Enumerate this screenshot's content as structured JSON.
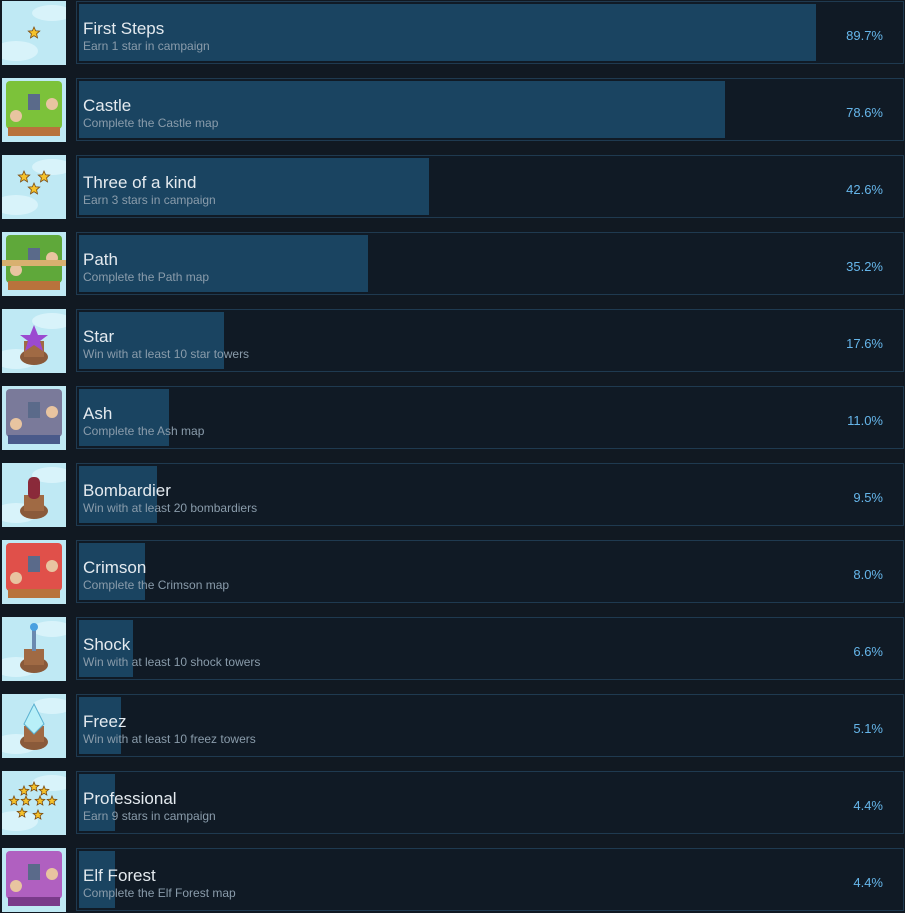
{
  "colors": {
    "bar": "#1a4461",
    "percent": "#66b6ea",
    "background": "#111922"
  },
  "achievements": [
    {
      "title": "First Steps",
      "description": "Earn 1 star in campaign",
      "percent": "89.7%",
      "value": 89.7,
      "icon": "one-star-icon",
      "theme": "sky"
    },
    {
      "title": "Castle",
      "description": "Complete the Castle map",
      "percent": "78.6%",
      "value": 78.6,
      "icon": "castle-map-icon",
      "theme": "green"
    },
    {
      "title": "Three of a kind",
      "description": "Earn 3 stars in campaign",
      "percent": "42.6%",
      "value": 42.6,
      "icon": "three-stars-icon",
      "theme": "sky"
    },
    {
      "title": "Path",
      "description": "Complete the Path map",
      "percent": "35.2%",
      "value": 35.2,
      "icon": "path-map-icon",
      "theme": "green"
    },
    {
      "title": "Star",
      "description": "Win with at least 10 star towers",
      "percent": "17.6%",
      "value": 17.6,
      "icon": "star-tower-icon",
      "theme": "tower-purple"
    },
    {
      "title": "Ash",
      "description": "Complete the Ash map",
      "percent": "11.0%",
      "value": 11.0,
      "icon": "ash-map-icon",
      "theme": "ash"
    },
    {
      "title": "Bombardier",
      "description": "Win with at least 20 bombardiers",
      "percent": "9.5%",
      "value": 9.5,
      "icon": "bombardier-tower-icon",
      "theme": "tower-red"
    },
    {
      "title": "Crimson",
      "description": "Complete the Crimson map",
      "percent": "8.0%",
      "value": 8.0,
      "icon": "crimson-map-icon",
      "theme": "crimson"
    },
    {
      "title": "Shock",
      "description": "Win with at least 10 shock towers",
      "percent": "6.6%",
      "value": 6.6,
      "icon": "shock-tower-icon",
      "theme": "tower-blue"
    },
    {
      "title": "Freez",
      "description": "Win with at least 10 freez towers",
      "percent": "5.1%",
      "value": 5.1,
      "icon": "freez-tower-icon",
      "theme": "tower-ice"
    },
    {
      "title": "Professional",
      "description": "Earn 9 stars in campaign",
      "percent": "4.4%",
      "value": 4.4,
      "icon": "nine-stars-icon",
      "theme": "sky"
    },
    {
      "title": "Elf Forest",
      "description": "Complete the Elf Forest map",
      "percent": "4.4%",
      "value": 4.4,
      "icon": "elf-forest-map-icon",
      "theme": "purple"
    }
  ]
}
